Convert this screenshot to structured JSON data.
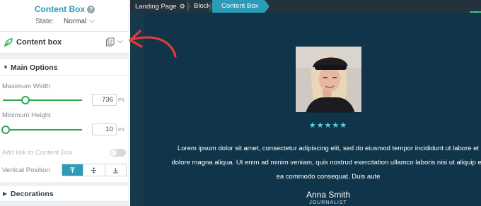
{
  "panel": {
    "title": "Content Box",
    "help_icon": "?",
    "state_label": "State:",
    "state_value": "Normal",
    "element_name": "Content box",
    "main_options": {
      "title": "Main Options",
      "max_width": {
        "label": "Maximum Width",
        "value": "736",
        "unit": "PX",
        "level": 0.25
      },
      "min_height": {
        "label": "Minimum Height",
        "value": "10",
        "unit": "PX",
        "level": 0.0
      },
      "add_link_label": "Add link to Content Box",
      "vertical_position_label": "Vertical Position",
      "vertical_position_selected": "top"
    },
    "decorations_title": "Decorations"
  },
  "breadcrumb": {
    "items": [
      "Landing Page",
      "Block",
      "Content Box"
    ]
  },
  "content": {
    "stars": "★★★★★",
    "rating": 5,
    "quote_lines": [
      "Lorem ipsum dolor sit amet, consectetur adipiscing elit, sed do eiusmod tempor incididunt ut labore et",
      "dolore magna aliqua. Ut enim ad minim veniam, quis nostrud exercitation ullamco laboris nisi ut aliquip ex",
      "ea commodo consequat. Duis aute"
    ],
    "author_name": "Anna Smith",
    "author_role": "JOURNALIST"
  },
  "colors": {
    "accent": "#2b9bb8",
    "slider": "#2ea84a",
    "canvas_bg": "#10354a",
    "annotation": "#e53935",
    "add_button": "#2ecc71",
    "stars": "#5bd0d8"
  },
  "icons": [
    "help-icon",
    "leaf-icon",
    "copy-settings-icon",
    "chevron-down-icon",
    "caret-down-icon",
    "caret-right-icon",
    "gear-icon",
    "plus-icon",
    "align-top-icon",
    "align-middle-icon",
    "align-bottom-icon",
    "collapse-left-icon"
  ]
}
